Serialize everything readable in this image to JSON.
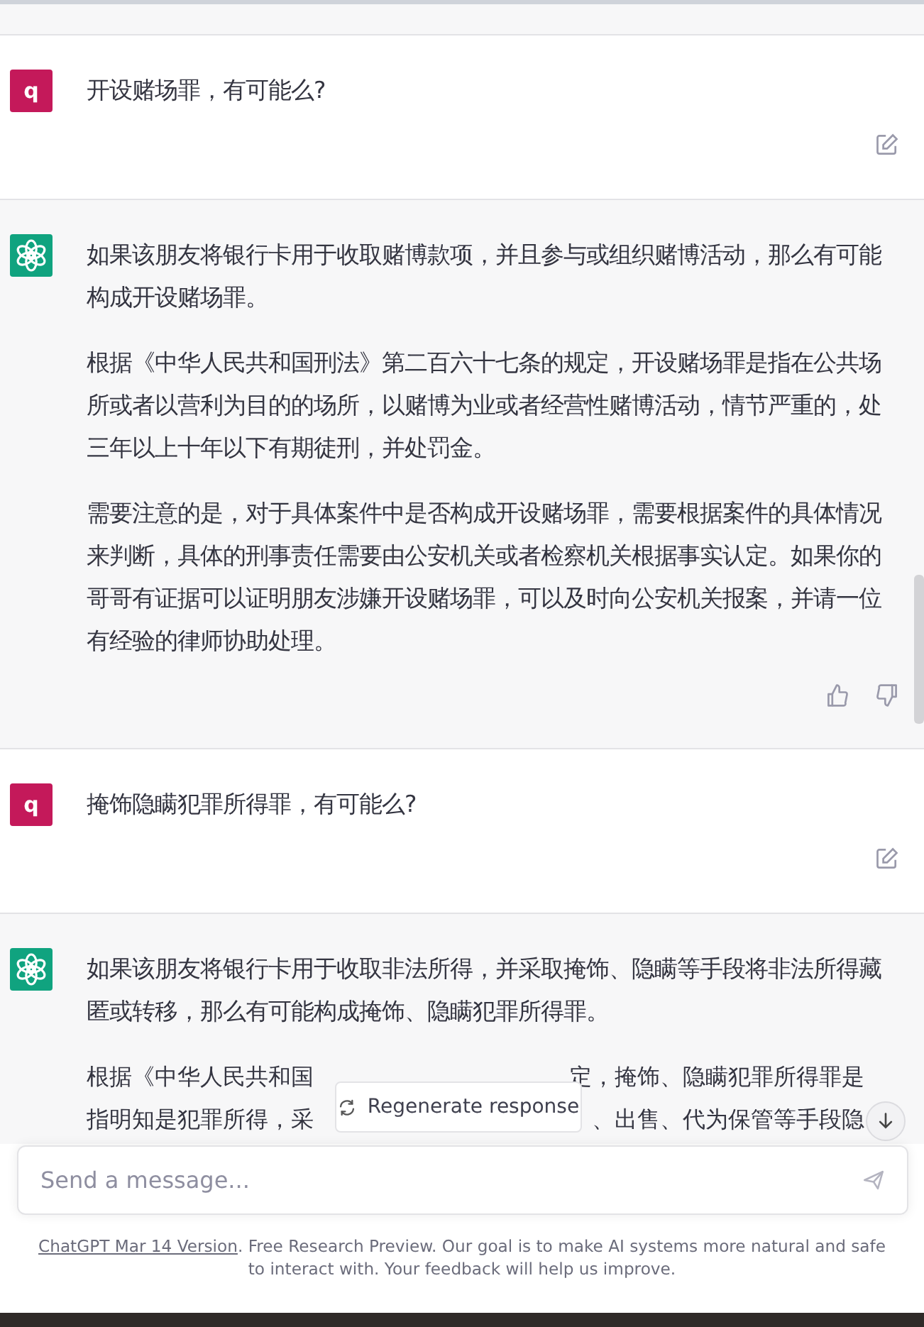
{
  "messages": [
    {
      "kind": "user",
      "avatar": "q",
      "paragraphs": [
        {
          "kind": "text",
          "text": "开设赌场罪，有可能么?"
        }
      ]
    },
    {
      "kind": "assistant",
      "actions_shown": true,
      "paragraphs": [
        {
          "kind": "text",
          "text": "如果该朋友将银行卡用于收取赌博款项，并且参与或组织赌博活动，那么有可能构成开设赌场罪。"
        },
        {
          "kind": "text",
          "text": "根据《中华人民共和国刑法》第二百六十七条的规定，开设赌场罪是指在公共场所或者以营利为目的的场所，以赌博为业或者经营性赌博活动，情节严重的，处三年以上十年以下有期徒刑，并处罚金。"
        },
        {
          "kind": "text",
          "text": "需要注意的是，对于具体案件中是否构成开设赌场罪，需要根据案件的具体情况来判断，具体的刑事责任需要由公安机关或者检察机关根据事实认定。如果你的哥哥有证据可以证明朋友涉嫌开设赌场罪，可以及时向公安机关报案，并请一位有经验的律师协助处理。"
        }
      ]
    },
    {
      "kind": "user",
      "avatar": "q",
      "paragraphs": [
        {
          "kind": "text",
          "text": "掩饰隐瞒犯罪所得罪，有可能么?"
        }
      ]
    },
    {
      "kind": "assistant",
      "actions_shown": false,
      "paragraphs": [
        {
          "kind": "text",
          "text": "如果该朋友将银行卡用于收取非法所得，并采取掩饰、隐瞒等手段将非法所得藏匿或转移，那么有可能构成掩饰、隐瞒犯罪所得罪。"
        },
        {
          "kind": "covered",
          "lines": [
            [
              "根据《中华人民共和国",
              "定，掩饰、隐瞒犯罪所得罪是"
            ],
            [
              "指明知是犯罪所得，采",
              "、出售、代为保管等手段隐"
            ]
          ]
        }
      ]
    }
  ],
  "regenerate_button": "Regenerate response",
  "composer": {
    "placeholder": "Send a message..."
  },
  "footer": {
    "link": "ChatGPT Mar 14 Version",
    "text": ". Free Research Preview. Our goal is to make AI systems more natural and safe to interact with. Your feedback will help us improve."
  }
}
